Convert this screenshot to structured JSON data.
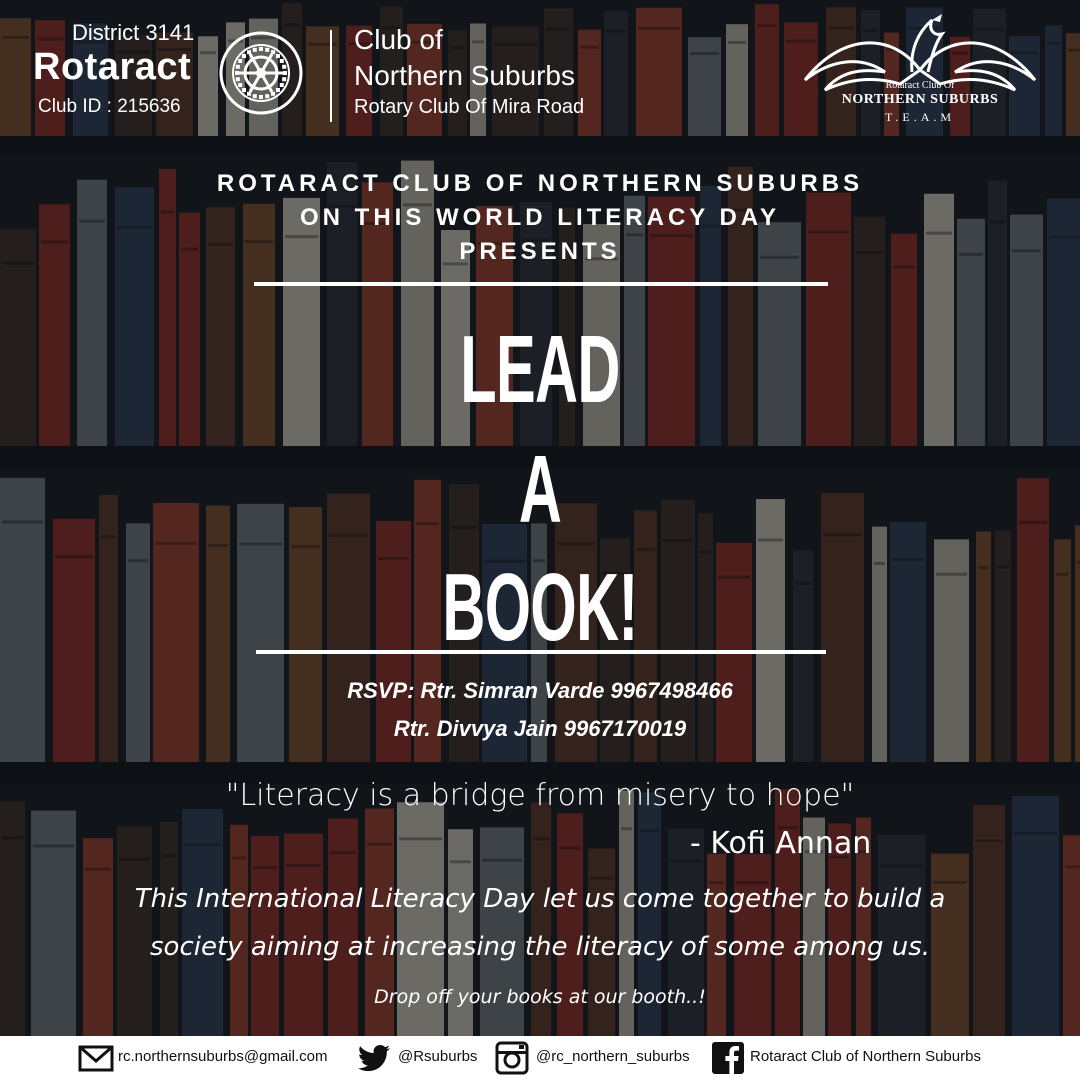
{
  "header": {
    "district": "District 3141",
    "brand": "Rotaract",
    "club_id": "Club ID : 215636",
    "wheel_top_text": "ROTARY",
    "wheel_bottom_text": "INTERNATIONAL",
    "club_line1": "Club of",
    "club_line2": "Northern Suburbs",
    "club_line3": "Rotary Club Of Mira Road"
  },
  "team_logo": {
    "subtitle": "Rotaract Club Of",
    "name": "NORTHERN SUBURBS",
    "team": "T.E.A.M"
  },
  "headline": {
    "line1": "ROTARACT CLUB OF NORTHERN SUBURBS",
    "line2": "ON THIS WORLD LITERACY DAY",
    "line3": "PRESENTS"
  },
  "title": {
    "word1": "LEAD",
    "word2": "A",
    "word3": "BOOK!"
  },
  "rsvp": {
    "line1": "RSVP: Rtr. Simran Varde  9967498466",
    "line2": "Rtr. Divvya Jain   9967170019"
  },
  "quote": {
    "text": "\"Literacy is a bridge from misery to hope\"",
    "author": "- Kofi Annan"
  },
  "message": {
    "line1": "This International Literacy Day let us come together to build a",
    "line2": "society aiming at increasing the literacy of some among us.",
    "dropoff": "Drop off your books at our booth..!"
  },
  "footer": {
    "email": "rc.northernsuburbs@gmail.com",
    "twitter": "@Rsuburbs",
    "instagram": "@rc_northern_suburbs",
    "facebook": "Rotaract Club of Northern Suburbs",
    "icons": [
      "mail-icon",
      "twitter-icon",
      "instagram-icon",
      "facebook-icon"
    ]
  },
  "colors": {
    "background": "#16191d",
    "text": "#ffffff",
    "footer_bg": "#ffffff",
    "book_red": "#8e2a24",
    "book_brown": "#7a4a2a",
    "book_blue": "#2c3b52",
    "book_grey": "#6e7478"
  }
}
